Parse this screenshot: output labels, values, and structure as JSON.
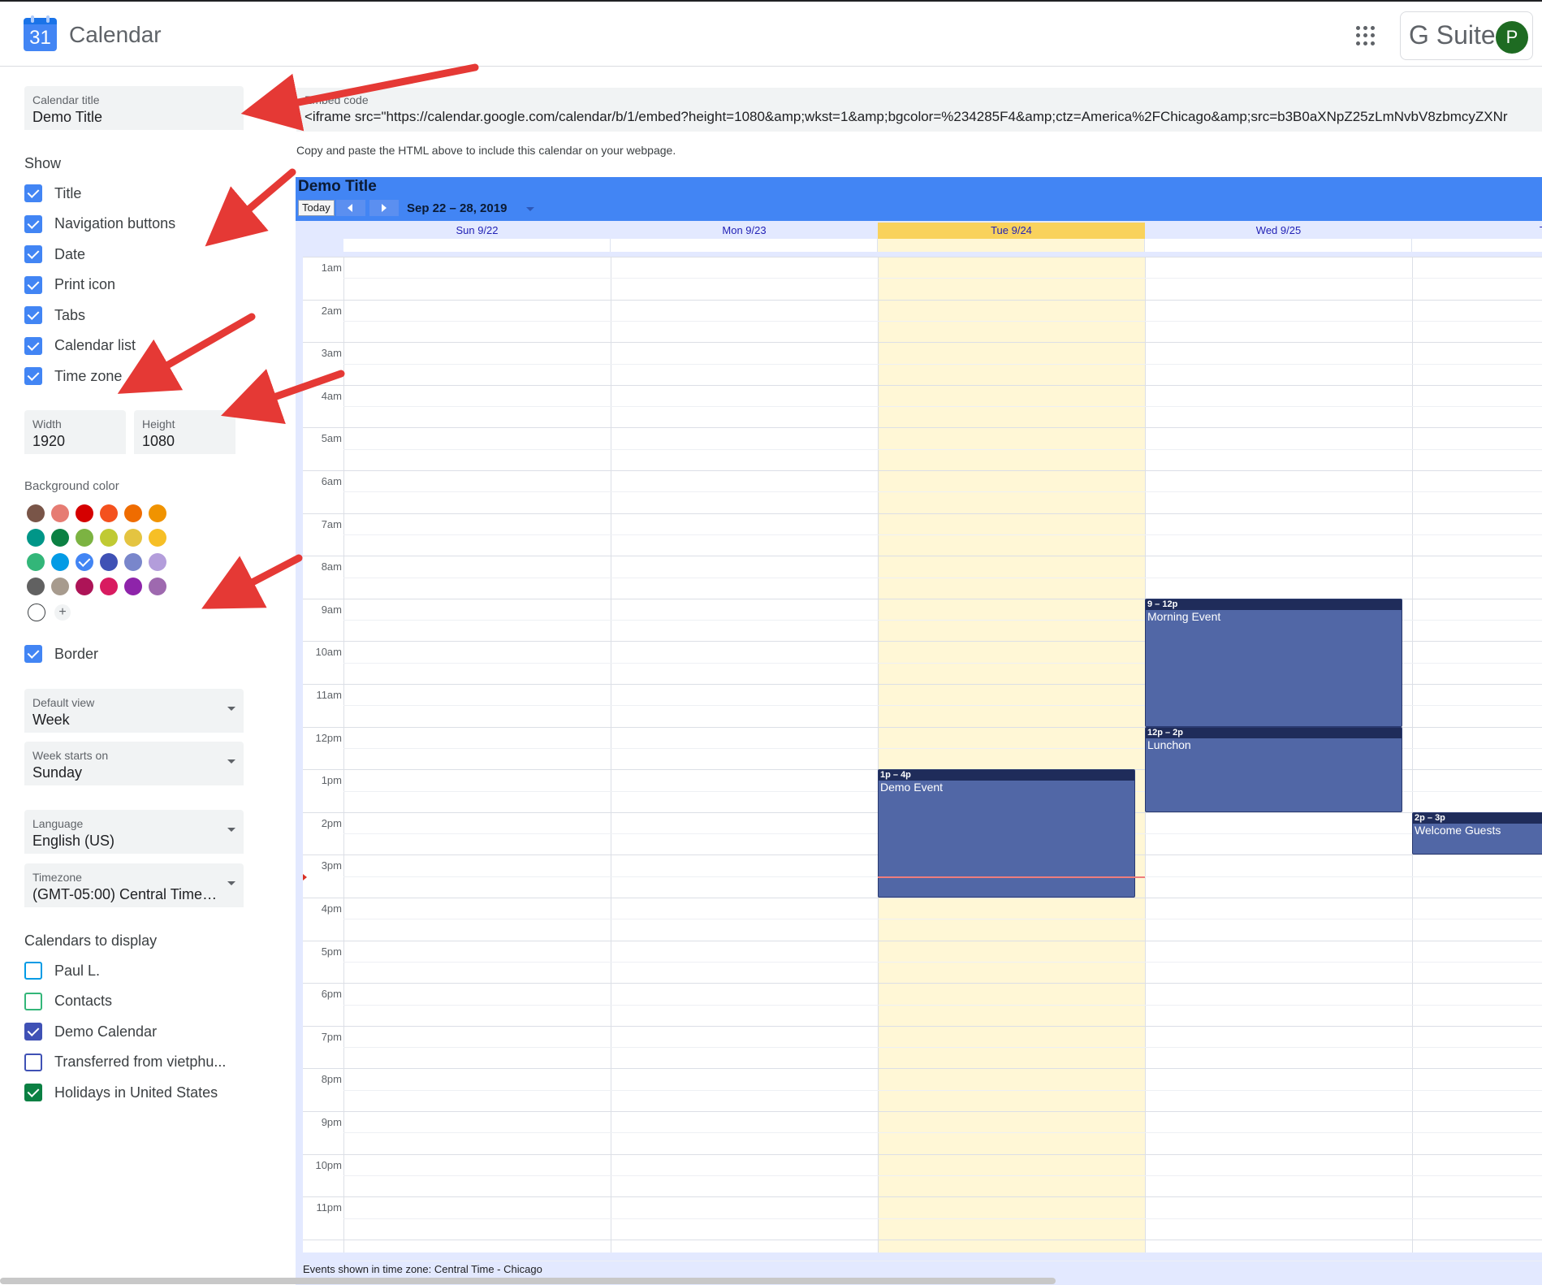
{
  "header": {
    "logo_number": "31",
    "app_title": "Calendar",
    "suite_label": "G Suite",
    "avatar_initial": "P"
  },
  "sidebar": {
    "calendar_title": {
      "label": "Calendar title",
      "value": "Demo Title"
    },
    "show_heading": "Show",
    "show_options": [
      {
        "label": "Title",
        "checked": true
      },
      {
        "label": "Navigation buttons",
        "checked": true
      },
      {
        "label": "Date",
        "checked": true
      },
      {
        "label": "Print icon",
        "checked": true
      },
      {
        "label": "Tabs",
        "checked": true
      },
      {
        "label": "Calendar list",
        "checked": true
      },
      {
        "label": "Time zone",
        "checked": true
      }
    ],
    "width": {
      "label": "Width",
      "value": "1920"
    },
    "height": {
      "label": "Height",
      "value": "1080"
    },
    "background_color_label": "Background color",
    "swatches": [
      [
        "#795548",
        "#e67c73",
        "#d50000",
        "#f4511e",
        "#ef6c00",
        "#f09300"
      ],
      [
        "#009688",
        "#0b8043",
        "#7cb342",
        "#c0ca33",
        "#e4c441",
        "#f6bf26"
      ],
      [
        "#33b679",
        "#039be5",
        "#4285f4",
        "#3f51b5",
        "#7986cb",
        "#b39ddb"
      ],
      [
        "#616161",
        "#a79b8e",
        "#ad1457",
        "#d81b60",
        "#8e24aa",
        "#9e69af"
      ]
    ],
    "selected_swatch": "#4285f4",
    "border": {
      "label": "Border",
      "checked": true
    },
    "default_view": {
      "label": "Default view",
      "value": "Week"
    },
    "week_starts": {
      "label": "Week starts on",
      "value": "Sunday"
    },
    "language": {
      "label": "Language",
      "value": "English (US)"
    },
    "timezone": {
      "label": "Timezone",
      "value": "(GMT-05:00) Central Time - ..."
    },
    "calendars_heading": "Calendars to display",
    "calendars": [
      {
        "label": "Paul L.",
        "checked": false,
        "color": "#039be5"
      },
      {
        "label": "Contacts",
        "checked": false,
        "color": "#33b679"
      },
      {
        "label": "Demo Calendar",
        "checked": true,
        "color": "#3f51b5"
      },
      {
        "label": "Transferred from vietphu...",
        "checked": false,
        "color": "#3f51b5"
      },
      {
        "label": "Holidays in United States",
        "checked": true,
        "color": "#0b8043"
      }
    ]
  },
  "embed": {
    "label": "Embed code",
    "code": "<iframe src=\"https://calendar.google.com/calendar/b/1/embed?height=1080&amp;wkst=1&amp;bgcolor=%234285F4&amp;ctz=America%2FChicago&amp;src=b3B0aXNpZ25zLmNvbV8zbmcyZXNr",
    "help": "Copy and paste the HTML above to include this calendar on your webpage."
  },
  "preview": {
    "title": "Demo Title",
    "today_label": "Today",
    "date_range": "Sep 22 – 28, 2019",
    "days": [
      "Sun 9/22",
      "Mon 9/23",
      "Tue 9/24",
      "Wed 9/25",
      "Th"
    ],
    "today_index": 2,
    "hours": [
      "1am",
      "2am",
      "3am",
      "4am",
      "5am",
      "6am",
      "7am",
      "8am",
      "9am",
      "10am",
      "11am",
      "12pm",
      "1pm",
      "2pm",
      "3pm",
      "4pm",
      "5pm",
      "6pm",
      "7pm",
      "8pm",
      "9pm",
      "10pm",
      "11pm"
    ],
    "events": [
      {
        "time": "9 – 12p",
        "name": "Morning Event",
        "day": 3,
        "start": 9,
        "end": 12
      },
      {
        "time": "12p – 2p",
        "name": "Lunchon",
        "day": 3,
        "start": 12,
        "end": 14
      },
      {
        "time": "1p – 4p",
        "name": "Demo Event",
        "day": 2,
        "start": 13,
        "end": 16
      },
      {
        "time": "2p – 3p",
        "name": "Welcome Guests",
        "day": 4,
        "start": 14,
        "end": 15
      }
    ],
    "timezone_note": "Events shown in time zone: Central Time - Chicago"
  },
  "colors": {
    "accent": "#4285f4",
    "event": "#5167a6",
    "today": "#fff7d6",
    "arrow": "#e53935"
  }
}
